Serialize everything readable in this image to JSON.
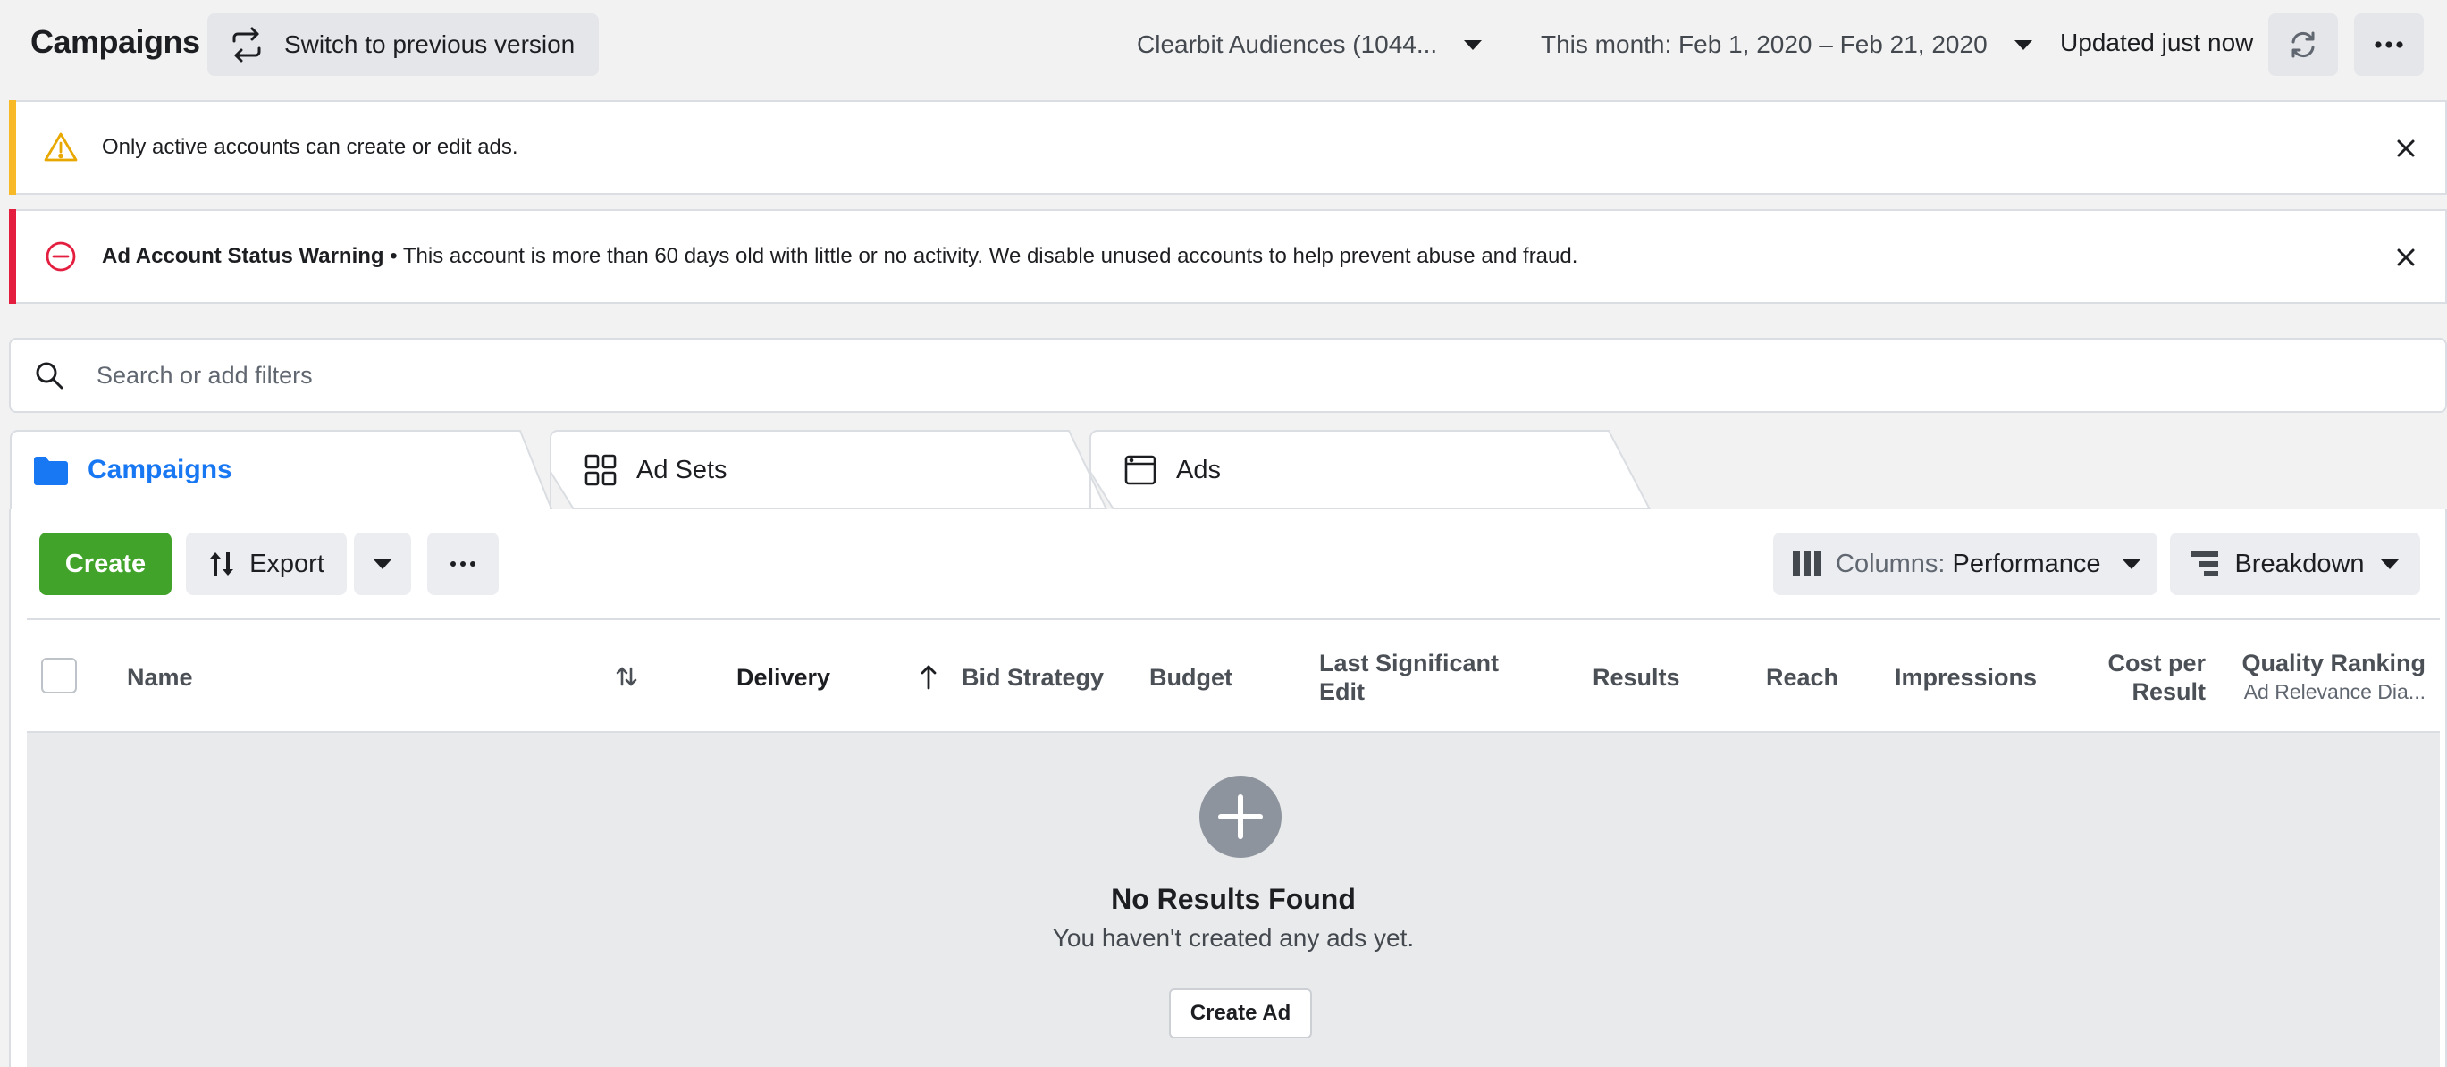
{
  "header": {
    "title": "Campaigns",
    "switch_label": "Switch to previous version",
    "account_label": "Clearbit Audiences (1044...",
    "date_range_label": "This month: Feb 1, 2020 – Feb 21, 2020",
    "updated_label": "Updated just now"
  },
  "notices": [
    {
      "type": "warning",
      "title": "",
      "text": "Only active accounts can create or edit ads.",
      "accent": "#f7b928"
    },
    {
      "type": "error",
      "title": "Ad Account Status Warning",
      "text": " • This account is more than 60 days old with little or no activity. We disable unused accounts to help prevent abuse and fraud.",
      "accent": "#e41e3f"
    }
  ],
  "search": {
    "placeholder": "Search or add filters"
  },
  "tabs": [
    {
      "label": "Campaigns",
      "icon": "folder-icon",
      "active": true
    },
    {
      "label": "Ad Sets",
      "icon": "grid-icon",
      "active": false
    },
    {
      "label": "Ads",
      "icon": "ad-window-icon",
      "active": false
    }
  ],
  "toolbar": {
    "create_label": "Create",
    "export_label": "Export",
    "columns_prefix": "Columns:",
    "columns_value": "Performance",
    "breakdown_label": "Breakdown"
  },
  "table": {
    "columns": {
      "name": "Name",
      "delivery": "Delivery",
      "bid_strategy": "Bid Strategy",
      "budget": "Budget",
      "last_edit_line1": "Last Significant",
      "last_edit_line2": "Edit",
      "results": "Results",
      "reach": "Reach",
      "impressions": "Impressions",
      "cost_line1": "Cost per",
      "cost_line2": "Result",
      "quality_line1": "Quality Ranking",
      "quality_line2": "Ad Relevance Dia..."
    }
  },
  "empty_state": {
    "title": "No Results Found",
    "subtitle": "You haven't created any ads yet.",
    "button_label": "Create Ad"
  },
  "colors": {
    "accent_blue": "#1877f2",
    "create_green": "#42a32a"
  }
}
